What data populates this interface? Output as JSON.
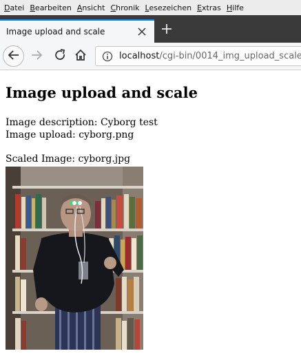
{
  "menu": {
    "items": [
      {
        "ul": "D",
        "rest": "atei"
      },
      {
        "ul": "B",
        "rest": "earbeiten"
      },
      {
        "ul": "A",
        "rest": "nsicht"
      },
      {
        "ul": "C",
        "rest": "hronik"
      },
      {
        "ul": "L",
        "rest": "esezeichen"
      },
      {
        "ul": "E",
        "rest": "xtras"
      },
      {
        "ul": "H",
        "rest": "ilfe"
      }
    ]
  },
  "tab": {
    "title": "Image upload and scale"
  },
  "address": {
    "host": "localhost",
    "path": "/cgi-bin/0014_img_upload_scale"
  },
  "page": {
    "heading": "Image upload and scale",
    "description": "Image description: Cyborg test",
    "upload": "Image upload: cyborg.png",
    "scaled": "Scaled Image: cyborg.jpg"
  },
  "icons": {
    "back": "back-arrow-icon",
    "forward": "forward-arrow-icon",
    "reload": "reload-icon",
    "home": "home-icon",
    "info": "info-icon",
    "close": "close-icon",
    "newtab": "plus-icon"
  },
  "colors": {
    "tab_accent": "#0a84ff",
    "tabstrip": "#3a3a3a",
    "toolbar": "#f5f6f7"
  }
}
